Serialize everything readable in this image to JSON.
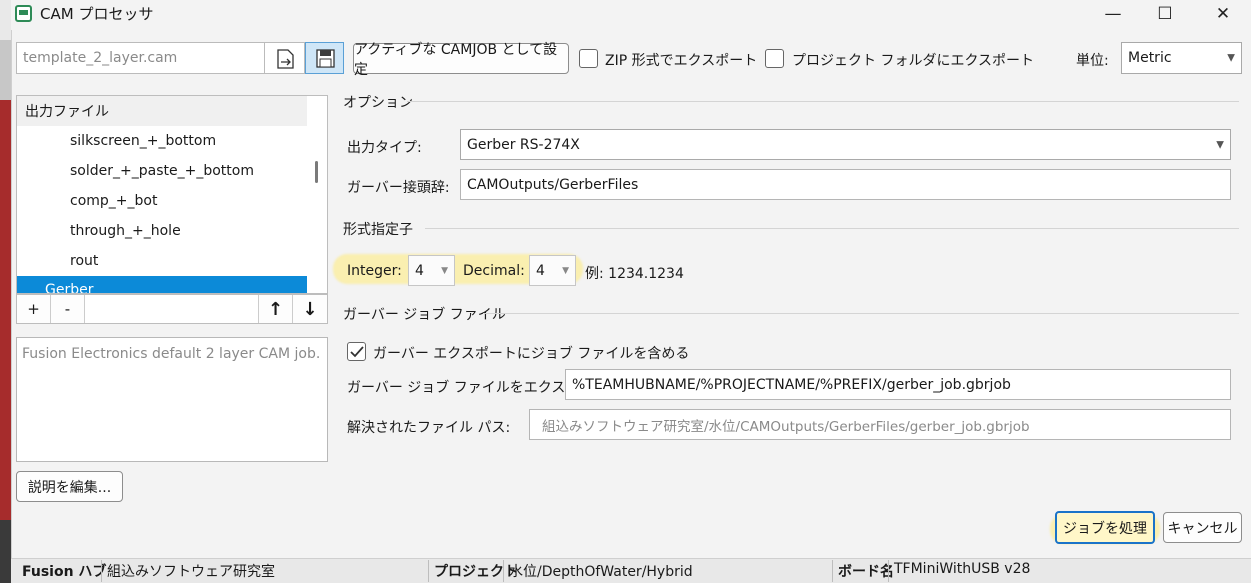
{
  "window": {
    "title": "CAM プロセッサ",
    "minimize_glyph": "—",
    "maximize_glyph": "☐",
    "close_glyph": "✕"
  },
  "toolbar": {
    "file_name_value": "template_2_layer.cam",
    "set_active_label": "アクティブな CAMJOB として設定",
    "zip_export_label": "ZIP 形式でエクスポート",
    "project_folder_export_label": "プロジェクト フォルダにエクスポート",
    "unit_label": "単位:",
    "unit_value": "Metric"
  },
  "tree": {
    "header": "出力ファイル",
    "items": [
      "silkscreen_+_bottom",
      "solder_+_paste_+_bottom",
      "comp_+_bot",
      "through_+_hole",
      "rout"
    ],
    "selected_item": "Gerber",
    "add_label": "+",
    "remove_label": "-",
    "up_glyph": "🡅",
    "down_glyph": "🡇"
  },
  "description": {
    "text": "Fusion Electronics default 2 layer CAM job.",
    "edit_button": "説明を編集..."
  },
  "options": {
    "section_title": "オプション",
    "output_type_label": "出力タイプ:",
    "output_type_value": "Gerber RS-274X",
    "gerber_prefix_label": "ガーバー接頭辞:",
    "gerber_prefix_value": "CAMOutputs/GerberFiles"
  },
  "format": {
    "section_title": "形式指定子",
    "integer_label": "Integer:",
    "integer_value": "4",
    "decimal_label": "Decimal:",
    "decimal_value": "4",
    "example_text": "例: 1234.1234"
  },
  "gerber_job": {
    "section_title": "ガーバー ジョブ ファイル",
    "include_label": "ガーバー エクスポートにジョブ ファイルを含める",
    "export_label": "ガーバー ジョブ ファイルをエクスポート:",
    "export_value": "%TEAMHUBNAME/%PROJECTNAME/%PREFIX/gerber_job.gbrjob",
    "resolved_label": "解決されたファイル パス:",
    "resolved_value": "組込みソフトウェア研究室/水位/CAMOutputs/GerberFiles/gerber_job.gbrjob"
  },
  "actions": {
    "process_job": "ジョブを処理",
    "cancel": "キャンセル"
  },
  "status_bar": {
    "hub_key": "Fusion ハブ",
    "hub_value": "組込みソフトウェア研究室",
    "project_key": "プロジェクト",
    "project_value": "水位/DepthOfWater/Hybrid",
    "board_key": "ボード名",
    "board_value": "TFMiniWithUSB v28"
  },
  "icons": {
    "app": "cam-processor-icon",
    "load": "load-file-icon",
    "save": "save-icon",
    "accent_color": "#0c8ad8",
    "highlight_color": "#ffeb78"
  }
}
